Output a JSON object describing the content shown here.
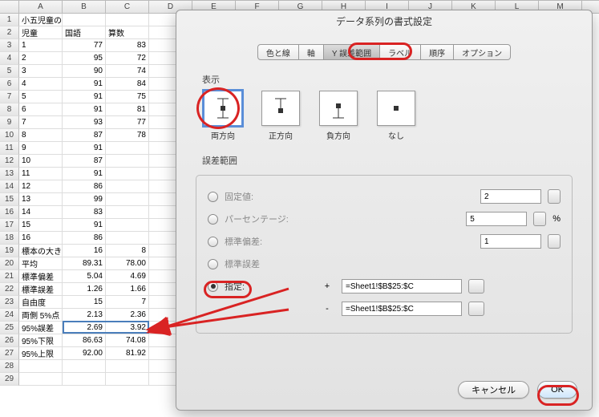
{
  "columns": [
    "A",
    "B",
    "C",
    "D",
    "E",
    "F",
    "G",
    "H",
    "I",
    "J",
    "K",
    "L",
    "M"
  ],
  "sheet": {
    "title": "小五児童の試験の得点",
    "headers": {
      "a": "児童",
      "b": "国語",
      "c": "算数"
    },
    "rows": [
      {
        "n": 3,
        "a": "1",
        "b": "77",
        "c": "83"
      },
      {
        "n": 4,
        "a": "2",
        "b": "95",
        "c": "72"
      },
      {
        "n": 5,
        "a": "3",
        "b": "90",
        "c": "74"
      },
      {
        "n": 6,
        "a": "4",
        "b": "91",
        "c": "84"
      },
      {
        "n": 7,
        "a": "5",
        "b": "91",
        "c": "75"
      },
      {
        "n": 8,
        "a": "6",
        "b": "91",
        "c": "81"
      },
      {
        "n": 9,
        "a": "7",
        "b": "93",
        "c": "77"
      },
      {
        "n": 10,
        "a": "8",
        "b": "87",
        "c": "78"
      },
      {
        "n": 11,
        "a": "9",
        "b": "91",
        "c": ""
      },
      {
        "n": 12,
        "a": "10",
        "b": "87",
        "c": ""
      },
      {
        "n": 13,
        "a": "11",
        "b": "91",
        "c": ""
      },
      {
        "n": 14,
        "a": "12",
        "b": "86",
        "c": ""
      },
      {
        "n": 15,
        "a": "13",
        "b": "99",
        "c": ""
      },
      {
        "n": 16,
        "a": "14",
        "b": "83",
        "c": ""
      },
      {
        "n": 17,
        "a": "15",
        "b": "91",
        "c": ""
      },
      {
        "n": 18,
        "a": "16",
        "b": "86",
        "c": ""
      }
    ],
    "summary": [
      {
        "n": 19,
        "a": "標本の大き",
        "b": "16",
        "c": "8"
      },
      {
        "n": 20,
        "a": "平均",
        "b": "89.31",
        "c": "78.00"
      },
      {
        "n": 21,
        "a": "標準偏差",
        "b": "5.04",
        "c": "4.69"
      },
      {
        "n": 22,
        "a": "標準誤差",
        "b": "1.26",
        "c": "1.66"
      },
      {
        "n": 23,
        "a": "自由度",
        "b": "15",
        "c": "7"
      },
      {
        "n": 24,
        "a": "両側 5%点",
        "b": "2.13",
        "c": "2.36"
      },
      {
        "n": 25,
        "a": "95%誤差",
        "b": "2.69",
        "c": "3.92"
      },
      {
        "n": 26,
        "a": "95%下限",
        "b": "86.63",
        "c": "74.08"
      },
      {
        "n": 27,
        "a": "95%上限",
        "b": "92.00",
        "c": "81.92"
      }
    ]
  },
  "dialog": {
    "title": "データ系列の書式設定",
    "tabs": [
      "色と線",
      "軸",
      "Y 誤差範囲",
      "ラベル",
      "順序",
      "オプション"
    ],
    "display_label": "表示",
    "display_opts": [
      "両方向",
      "正方向",
      "負方向",
      "なし"
    ],
    "range_label": "誤差範囲",
    "opts": {
      "fixed": {
        "label": "固定値:",
        "value": "2"
      },
      "percent": {
        "label": "パーセンテージ:",
        "value": "5",
        "suffix": "%"
      },
      "stddev": {
        "label": "標準偏差:",
        "value": "1"
      },
      "stderr": {
        "label": "標準誤差"
      },
      "custom": {
        "label": "指定:",
        "plus": "+",
        "minus": "-",
        "plus_ref": "=Sheet1!$B$25:$C",
        "minus_ref": "=Sheet1!$B$25:$C"
      }
    },
    "buttons": {
      "cancel": "キャンセル",
      "ok": "OK"
    }
  }
}
